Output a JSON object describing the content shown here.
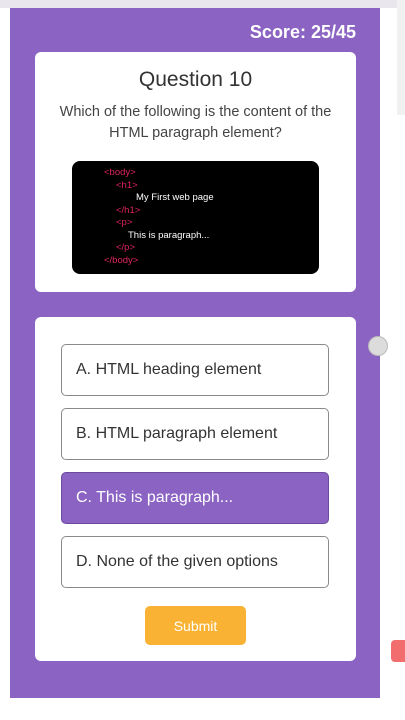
{
  "header": {
    "score_text": "Score: 25/45"
  },
  "question": {
    "title": "Question 10",
    "text": "Which of the following is the content of the HTML paragraph element?",
    "code": [
      {
        "tag": "<body>"
      },
      {
        "tag": "<h1>"
      },
      {
        "text": "My First web page"
      },
      {
        "tag": "</h1>"
      },
      {
        "tag": "<p>"
      },
      {
        "text": "This is paragraph..."
      },
      {
        "tag": "</p>"
      },
      {
        "tag": "</body>"
      }
    ]
  },
  "options": [
    {
      "label": "A. HTML heading element",
      "selected": false
    },
    {
      "label": "B. HTML paragraph element",
      "selected": false
    },
    {
      "label": "C. This is paragraph...",
      "selected": true
    },
    {
      "label": "D. None of the given options",
      "selected": false
    }
  ],
  "submit_label": "Submit",
  "colors": {
    "accent": "#8b63c2",
    "submit": "#f9b233",
    "code_tag": "#e0245e"
  }
}
